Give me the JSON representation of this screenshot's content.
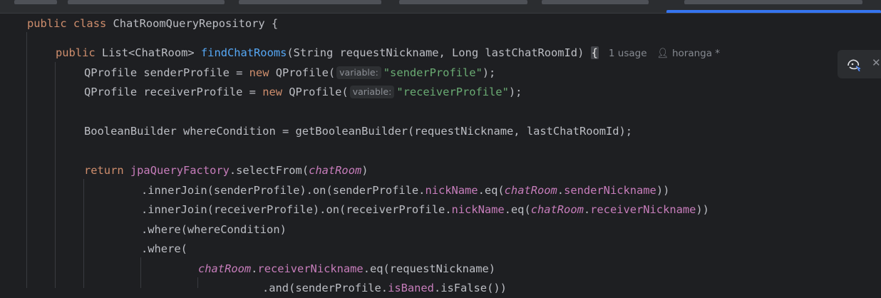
{
  "editor": {
    "lines": {
      "class_decl": {
        "kw1": "public",
        "kw2": "class",
        "name": "ChatRoomQueryRepository",
        "brace": " {"
      },
      "method_decl": {
        "kw": "public",
        "ret": "List<ChatRoom>",
        "name": "findChatRooms",
        "params": "(String requestNickname, Long lastChatRoomId)",
        "brace": "{",
        "usage": "1 usage",
        "author": "horanga *"
      },
      "sender_profile": {
        "decl": "QProfile senderProfile = ",
        "new": "new",
        "ctor": " QProfile(",
        "hint": "variable:",
        "str": "\"senderProfile\"",
        "end": ");"
      },
      "receiver_profile": {
        "decl": "QProfile receiverProfile = ",
        "new": "new",
        "ctor": " QProfile(",
        "hint": "variable:",
        "str": "\"receiverProfile\"",
        "end": ");"
      },
      "where_condition": {
        "text": "BooleanBuilder whereCondition = getBooleanBuilder(requestNickname, lastChatRoomId);"
      },
      "return_stmt": {
        "kw": "return",
        "field": "jpaQueryFactory",
        "call": ".selectFrom(",
        "arg": "chatRoom",
        "end": ")"
      },
      "join_sender": {
        "a": ".innerJoin(senderProfile).on(senderProfile.",
        "f1": "nickName",
        "b": ".eq(",
        "f2": "chatRoom",
        "c": ".",
        "f3": "senderNickname",
        "d": "))"
      },
      "join_receiver": {
        "a": ".innerJoin(receiverProfile).on(receiverProfile.",
        "f1": "nickName",
        "b": ".eq(",
        "f2": "chatRoom",
        "c": ".",
        "f3": "receiverNickname",
        "d": "))"
      },
      "where1": {
        "text": ".where(whereCondition)"
      },
      "where2": {
        "text": ".where("
      },
      "receiver_eq": {
        "f1": "chatRoom",
        "a": ".",
        "f2": "receiverNickname",
        "b": ".eq(requestNickname)"
      },
      "and_line": {
        "a": ".and(senderProfile.",
        "f1": "isBaned",
        "b": ".isFalse())"
      }
    }
  },
  "floating_toolbar": {
    "ai_icon": "ai-assistant-icon",
    "close_icon": "close-icon",
    "close_glyph": "✕"
  },
  "colors": {
    "background": "#1e1f22",
    "keyword": "#cf8e6d",
    "function": "#56a8f5",
    "field": "#c77dbb",
    "string": "#6aab73",
    "default_text": "#bcbec4",
    "active_tab": "#3574f0"
  }
}
